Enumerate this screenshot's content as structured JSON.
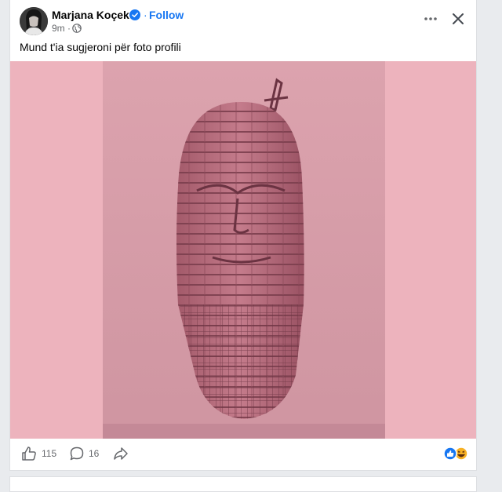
{
  "post": {
    "author_name": "Marjana Koçeku",
    "separator": "·",
    "follow_label": "Follow",
    "timestamp": "9m ·",
    "text": "Mund t'ia sugjeroni për foto profili",
    "image_alt": "Building shaped like a human head suspended over the sea, pink tint"
  },
  "actions": {
    "like_count": "115",
    "comment_count": "16"
  },
  "icons": {
    "verified": "verified-badge-icon",
    "globe": "globe-icon",
    "more": "more-options-icon",
    "close": "close-icon",
    "like": "thumbs-up-icon",
    "comment": "comment-bubble-icon",
    "share": "share-arrow-icon",
    "reactions": [
      "like-reaction-icon",
      "haha-reaction-icon"
    ]
  },
  "colors": {
    "accent": "#1877f2",
    "image_background": "#edb3bd",
    "photo_tint": "#d9a0ab",
    "muted_text": "#65676b"
  }
}
